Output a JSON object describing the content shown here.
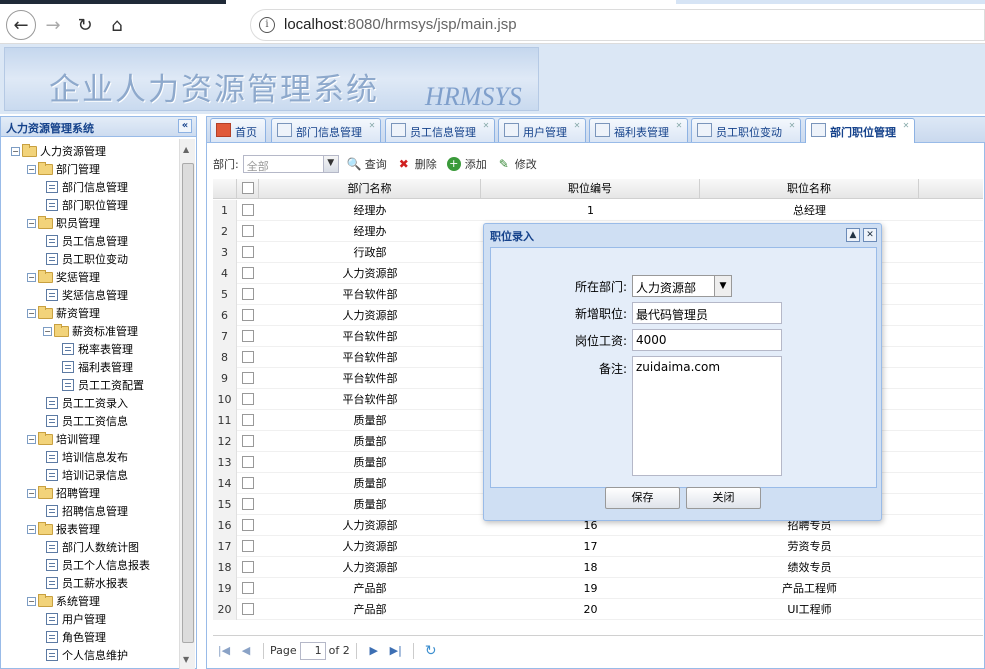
{
  "browser": {
    "url_host": "localhost",
    "url_rest": ":8080/hrmsys/jsp/main.jsp"
  },
  "banner": {
    "title": "企业人力资源管理系统",
    "subtitle": "HRMSYS"
  },
  "sidebar": {
    "title": "人力资源管理系统",
    "tree": [
      {
        "label": "人力资源管理",
        "level": 0,
        "type": "folder"
      },
      {
        "label": "部门管理",
        "level": 1,
        "type": "folder"
      },
      {
        "label": "部门信息管理",
        "level": 2,
        "type": "leaf"
      },
      {
        "label": "部门职位管理",
        "level": 2,
        "type": "leaf"
      },
      {
        "label": "职员管理",
        "level": 1,
        "type": "folder"
      },
      {
        "label": "员工信息管理",
        "level": 2,
        "type": "leaf"
      },
      {
        "label": "员工职位变动",
        "level": 2,
        "type": "leaf"
      },
      {
        "label": "奖惩管理",
        "level": 1,
        "type": "folder"
      },
      {
        "label": "奖惩信息管理",
        "level": 2,
        "type": "leaf"
      },
      {
        "label": "薪资管理",
        "level": 1,
        "type": "folder"
      },
      {
        "label": "薪资标准管理",
        "level": 2,
        "type": "folder"
      },
      {
        "label": "税率表管理",
        "level": 3,
        "type": "leaf"
      },
      {
        "label": "福利表管理",
        "level": 3,
        "type": "leaf"
      },
      {
        "label": "员工工资配置",
        "level": 3,
        "type": "leaf"
      },
      {
        "label": "员工工资录入",
        "level": 2,
        "type": "leaf"
      },
      {
        "label": "员工工资信息",
        "level": 2,
        "type": "leaf"
      },
      {
        "label": "培训管理",
        "level": 1,
        "type": "folder"
      },
      {
        "label": "培训信息发布",
        "level": 2,
        "type": "leaf"
      },
      {
        "label": "培训记录信息",
        "level": 2,
        "type": "leaf"
      },
      {
        "label": "招聘管理",
        "level": 1,
        "type": "folder"
      },
      {
        "label": "招聘信息管理",
        "level": 2,
        "type": "leaf"
      },
      {
        "label": "报表管理",
        "level": 1,
        "type": "folder"
      },
      {
        "label": "部门人数统计图",
        "level": 2,
        "type": "leaf"
      },
      {
        "label": "员工个人信息报表",
        "level": 2,
        "type": "leaf"
      },
      {
        "label": "员工薪水报表",
        "level": 2,
        "type": "leaf"
      },
      {
        "label": "系统管理",
        "level": 1,
        "type": "folder"
      },
      {
        "label": "用户管理",
        "level": 2,
        "type": "leaf"
      },
      {
        "label": "角色管理",
        "level": 2,
        "type": "leaf"
      },
      {
        "label": "个人信息维护",
        "level": 2,
        "type": "leaf"
      }
    ]
  },
  "tabs": [
    {
      "label": "首页",
      "closable": false,
      "active": false
    },
    {
      "label": "部门信息管理",
      "closable": true,
      "active": false
    },
    {
      "label": "员工信息管理",
      "closable": true,
      "active": false
    },
    {
      "label": "用户管理",
      "closable": true,
      "active": false
    },
    {
      "label": "福利表管理",
      "closable": true,
      "active": false
    },
    {
      "label": "员工职位变动",
      "closable": true,
      "active": false
    },
    {
      "label": "部门职位管理",
      "closable": true,
      "active": true
    }
  ],
  "toolbar": {
    "dept_label": "部门:",
    "dept_value": "全部",
    "query": "查询",
    "delete": "删除",
    "add": "添加",
    "edit": "修改"
  },
  "grid": {
    "columns": [
      "部门名称",
      "职位编号",
      "职位名称"
    ],
    "rows": [
      [
        "经理办",
        "1",
        "总经理"
      ],
      [
        "经理办",
        "",
        ""
      ],
      [
        "行政部",
        "",
        ""
      ],
      [
        "人力资源部",
        "",
        ""
      ],
      [
        "平台软件部",
        "",
        ""
      ],
      [
        "人力资源部",
        "",
        ""
      ],
      [
        "平台软件部",
        "",
        ""
      ],
      [
        "平台软件部",
        "",
        ""
      ],
      [
        "平台软件部",
        "",
        ""
      ],
      [
        "平台软件部",
        "",
        ""
      ],
      [
        "质量部",
        "",
        ""
      ],
      [
        "质量部",
        "",
        ""
      ],
      [
        "质量部",
        "",
        ""
      ],
      [
        "质量部",
        "",
        ""
      ],
      [
        "质量部",
        "",
        ""
      ],
      [
        "人力资源部",
        "16",
        "招聘专员"
      ],
      [
        "人力资源部",
        "17",
        "劳资专员"
      ],
      [
        "人力资源部",
        "18",
        "绩效专员"
      ],
      [
        "产品部",
        "19",
        "产品工程师"
      ],
      [
        "产品部",
        "20",
        "UI工程师"
      ]
    ]
  },
  "pager": {
    "page_label": "Page",
    "page_value": "1",
    "of_label": "of 2"
  },
  "dialog": {
    "title": "职位录入",
    "dept_label": "所在部门:",
    "dept_value": "人力资源部",
    "job_label": "新增职位:",
    "job_value": "最代码管理员",
    "salary_label": "岗位工资:",
    "salary_value": "4000",
    "note_label": "备注:",
    "note_value": "zuidaima.com",
    "save": "保存",
    "close": "关闭"
  }
}
